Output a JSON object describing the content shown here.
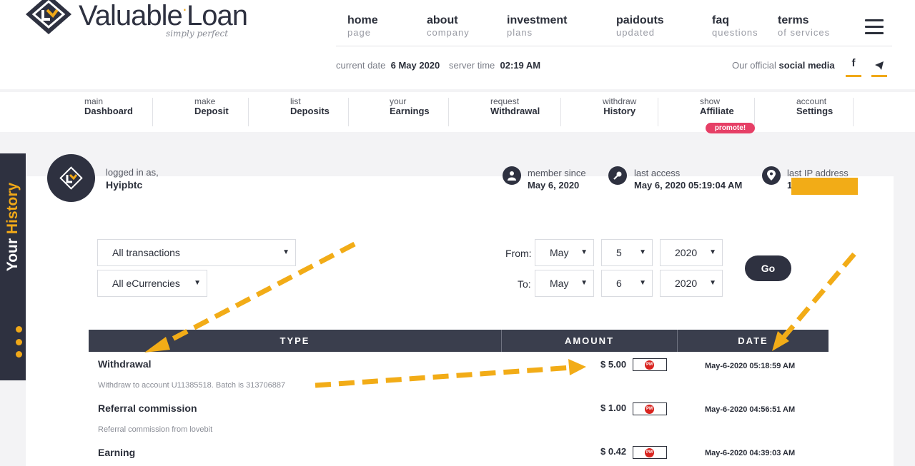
{
  "brand": {
    "name_part1": "Valuable",
    "name_part2": "Loan",
    "tagline": "simply perfect"
  },
  "topnav": [
    {
      "main": "home",
      "sub": "page"
    },
    {
      "main": "about",
      "sub": "company"
    },
    {
      "main": "investment",
      "sub": "plans"
    },
    {
      "main": "paidouts",
      "sub": "updated"
    },
    {
      "main": "faq",
      "sub": "questions"
    },
    {
      "main": "terms",
      "sub": "of services"
    }
  ],
  "infobar": {
    "date_label": "current date",
    "date_value": "6 May 2020",
    "time_label": "server time",
    "time_value": "02:19 AM",
    "social_label": "Our official",
    "social_value": "social media",
    "social_icons": [
      "facebook-icon",
      "telegram-icon"
    ]
  },
  "subnav": [
    {
      "small": "main",
      "big": "Dashboard"
    },
    {
      "small": "make",
      "big": "Deposit"
    },
    {
      "small": "list",
      "big": "Deposits"
    },
    {
      "small": "your",
      "big": "Earnings"
    },
    {
      "small": "request",
      "big": "Withdrawal"
    },
    {
      "small": "withdraw",
      "big": "History"
    },
    {
      "small": "show",
      "big": "Affiliate"
    },
    {
      "small": "account",
      "big": "Settings"
    }
  ],
  "promote_badge": "promote!",
  "side_tab": {
    "word1": "Your",
    "word2": "History"
  },
  "account": {
    "logged_label": "logged in as,",
    "username": "Hyipbtc",
    "member_label": "member since",
    "member_value": "May 6, 2020",
    "access_label": "last access",
    "access_value": "May 6, 2020 05:19:04 AM",
    "ip_label": "last IP address",
    "ip_value": "1"
  },
  "filters": {
    "transactions": "All transactions",
    "currencies": "All eCurrencies",
    "from_label": "From:",
    "to_label": "To:",
    "from": {
      "month": "May",
      "day": "5",
      "year": "2020"
    },
    "to": {
      "month": "May",
      "day": "6",
      "year": "2020"
    },
    "go_label": "Go"
  },
  "table": {
    "headers": [
      "TYPE",
      "AMOUNT",
      "DATE"
    ],
    "rows": [
      {
        "type": "Withdrawal",
        "desc": "Withdraw to account U11385518. Batch is 313706887",
        "amount": "$ 5.00",
        "date": "May-6-2020 05:18:59 AM"
      },
      {
        "type": "Referral commission",
        "desc": "Referral commission from lovebit",
        "amount": "$ 1.00",
        "date": "May-6-2020 04:56:51 AM"
      },
      {
        "type": "Earning",
        "desc": "",
        "amount": "$ 0.42",
        "date": "May-6-2020 04:39:03 AM"
      }
    ],
    "currency_badge": "PM"
  },
  "colors": {
    "accent": "#f0a818",
    "dark": "#2e3140",
    "promote": "#e63f66",
    "pm_red": "#d9241f"
  }
}
